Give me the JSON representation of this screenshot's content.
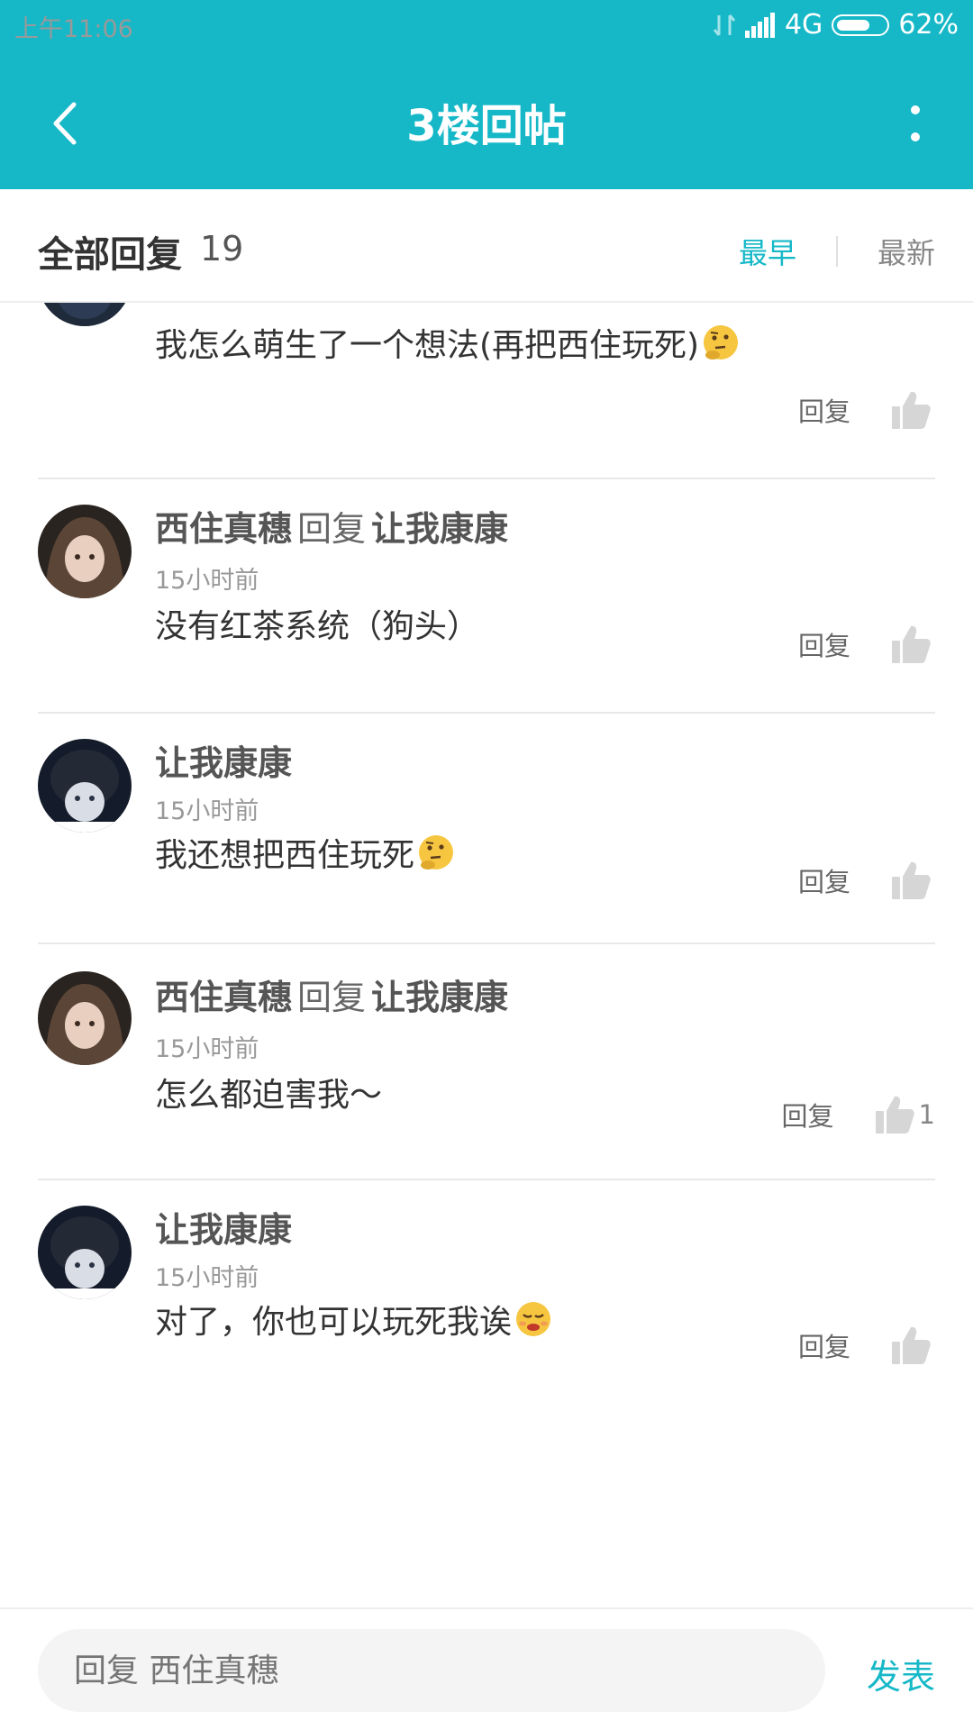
{
  "status_bar": {
    "time": "上午11:06",
    "network": "4G",
    "battery": "62%"
  },
  "app_bar": {
    "title": "3楼回帖"
  },
  "replies_header": {
    "label": "全部回复",
    "count": "19",
    "sort_earliest": "最早",
    "sort_newest": "最新"
  },
  "comments": [
    {
      "text": "我怎么萌生了一个想法(再把西住玩死)",
      "emoji": "thinking-face-icon",
      "reply_label": "回复",
      "likes": ""
    },
    {
      "author": "西住真穗",
      "reply_word": "回复",
      "reply_to": "让我康康",
      "time": "15小时前",
      "text": "没有红茶系统（狗头）",
      "reply_label": "回复",
      "likes": ""
    },
    {
      "author": "让我康康",
      "time": "15小时前",
      "text": "我还想把西住玩死",
      "emoji": "thinking-face-icon",
      "reply_label": "回复",
      "likes": ""
    },
    {
      "author": "西住真穗",
      "reply_word": "回复",
      "reply_to": "让我康康",
      "time": "15小时前",
      "text": "怎么都迫害我～",
      "reply_label": "回复",
      "likes": "1"
    },
    {
      "author": "让我康康",
      "time": "15小时前",
      "text": "对了，你也可以玩死我诶",
      "emoji": "disappointed-face-icon",
      "reply_label": "回复",
      "likes": ""
    }
  ],
  "composer": {
    "placeholder": "回复 西住真穗",
    "send_label": "发表"
  },
  "colors": {
    "accent": "#16b8c8"
  }
}
